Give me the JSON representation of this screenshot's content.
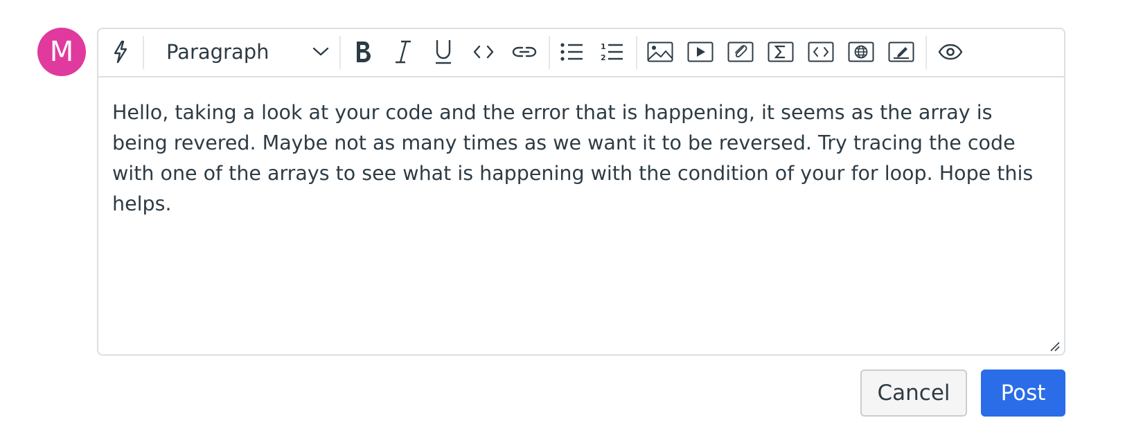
{
  "user": {
    "avatar_initial": "M",
    "avatar_color": "#e03a9e"
  },
  "editor": {
    "block_format": "Paragraph",
    "toolbar_icons": [
      "keyboard-shortcuts-icon",
      "bold-icon",
      "italic-icon",
      "underline-icon",
      "inline-code-icon",
      "link-icon",
      "bullet-list-icon",
      "numbered-list-icon",
      "insert-image-icon",
      "insert-media-icon",
      "attach-file-icon",
      "insert-math-icon",
      "insert-code-block-icon",
      "insert-embed-icon",
      "insert-drawing-icon",
      "preview-icon"
    ],
    "body_text": "Hello, taking a look at your code and the error that is happening, it seems as the array is being revered. Maybe not as many times as we want it to be reversed. Try tracing the code with one of the arrays to see what is happening with the condition of your for loop. Hope this helps."
  },
  "actions": {
    "cancel_label": "Cancel",
    "post_label": "Post"
  },
  "colors": {
    "primary": "#2b6ce8",
    "border": "#dcdfe3",
    "text": "#2d3b45"
  }
}
